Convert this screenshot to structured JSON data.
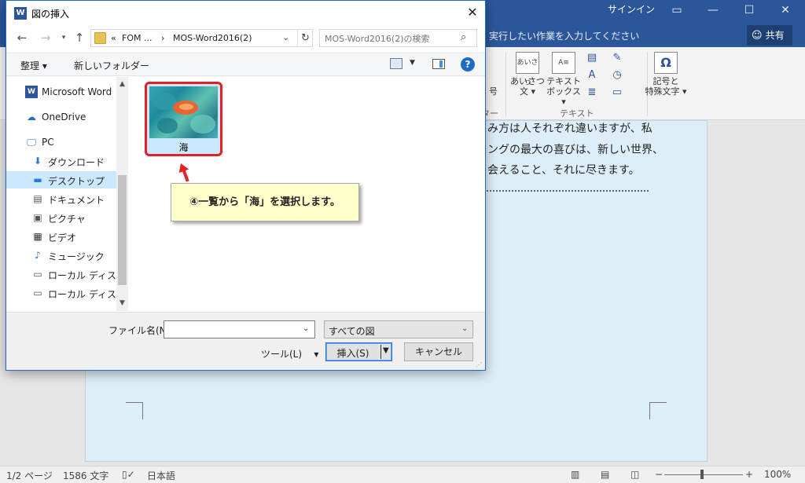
{
  "word": {
    "signin": "サインイン",
    "tell_me": "実行したい作業を入力してください",
    "share": "共有",
    "ribbon": {
      "greeting_label": "あいさつ",
      "greeting_btn": "あいさつ",
      "greeting_btn2": "文",
      "textbox_btn": "テキスト",
      "textbox_btn2": "ボックス",
      "symbol_btn": "記号と",
      "symbol_btn2": "特殊文字",
      "group_text": "テキスト",
      "group_left1": "号",
      "group_left2": "ター"
    },
    "document_lines": [
      "み方は人それぞれ違いますが、私",
      "ングの最大の喜びは、新しい世界、",
      "会えること、それに尽きます。"
    ],
    "status": {
      "page": "1/2 ページ",
      "words": "1586 文字",
      "language": "日本語",
      "zoom": "100%"
    }
  },
  "dialog": {
    "title": "図の挿入",
    "breadcrumb": [
      "FOM ...",
      "MOS-Word2016(2)"
    ],
    "search_placeholder": "MOS-Word2016(2)の検索",
    "toolbar": {
      "organize": "整理",
      "new_folder": "新しいフォルダー"
    },
    "nav_items": [
      {
        "label": "Microsoft Word",
        "icon": "word-icon"
      },
      {
        "label": "OneDrive",
        "icon": "cloud-icon"
      },
      {
        "label": "PC",
        "icon": "computer-icon"
      },
      {
        "label": "ダウンロード",
        "icon": "download-icon"
      },
      {
        "label": "デスクトップ",
        "icon": "desktop-icon"
      },
      {
        "label": "ドキュメント",
        "icon": "document-icon"
      },
      {
        "label": "ピクチャ",
        "icon": "picture-icon"
      },
      {
        "label": "ビデオ",
        "icon": "video-icon"
      },
      {
        "label": "ミュージック",
        "icon": "music-icon"
      },
      {
        "label": "ローカル ディスク (C",
        "icon": "drive-icon"
      },
      {
        "label": "ローカル ディスク (D",
        "icon": "drive-icon"
      }
    ],
    "selected_nav": "デスクトップ",
    "files": [
      {
        "name": "海"
      }
    ],
    "callout": "④一覧から「海」を選択します。",
    "filename_label": "ファイル名(N):",
    "filename_value": "",
    "filter_value": "すべての図",
    "tools": "ツール(L)",
    "insert": "挿入(S)",
    "cancel": "キャンセル"
  },
  "colors": {
    "word_blue": "#2b579a",
    "selection": "#cce8ff",
    "highlight_border": "#e51f26",
    "callout_bg": "#ffffcc"
  }
}
